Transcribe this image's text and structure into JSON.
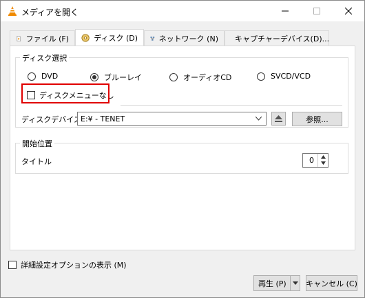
{
  "window": {
    "title": "メディアを開く"
  },
  "tabs": [
    {
      "label": "ファイル (F)",
      "icon": "file-icon"
    },
    {
      "label": "ディスク (D)",
      "icon": "disc-icon"
    },
    {
      "label": "ネットワーク (N)",
      "icon": "network-icon"
    },
    {
      "label": "キャプチャーデバイス(D)...",
      "icon": "capture-icon"
    }
  ],
  "disc_select": {
    "group_label": "ディスク選択",
    "options": [
      "DVD",
      "ブルーレイ",
      "オーディオCD",
      "SVCD/VCD"
    ],
    "selected": "ブルーレイ",
    "no_menu_label": "ディスクメニューなし",
    "device_label": "ディスクデバイス",
    "device_value": "E:¥ - TENET",
    "browse_label": "参照..."
  },
  "start_position": {
    "group_label": "開始位置",
    "title_label": "タイトル",
    "title_value": "0"
  },
  "footer": {
    "advanced_label": "詳細設定オプションの表示 (M)",
    "play_label": "再生 (P)",
    "cancel_label": "キャンセル (C)"
  },
  "colors": {
    "highlight": "#e00000",
    "cone": "#f08a00"
  }
}
